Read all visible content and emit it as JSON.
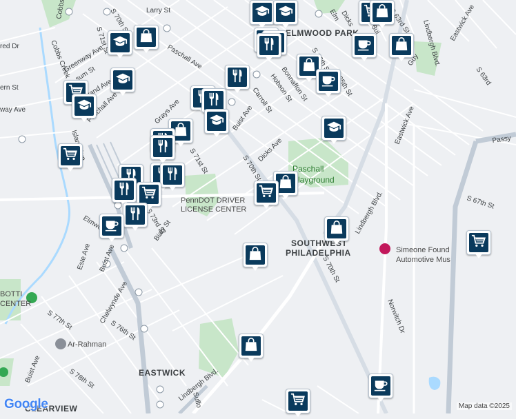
{
  "map": {
    "attribution": "Map data ©2025",
    "logo": "Google",
    "areas": {
      "elmwood_park": "ELMWOOD PARK",
      "southwest_1": "SOUTHWEST",
      "southwest_2": "PHILADELPHIA",
      "eastwick": "EASTWICK",
      "clearview": "CLEARVIEW"
    },
    "parks": {
      "paschall_1": "Paschall",
      "paschall_2": "Playground"
    },
    "pois": {
      "penndot_1": "PennDOT DRIVER",
      "penndot_2": "LICENSE CENTER",
      "simeone_1": "Simeone Found",
      "simeone_2": "Automotive Mus",
      "botti_1": "BOTTI",
      "botti_2": "CENTER",
      "ar_rahman": "Ar-Rahman"
    },
    "streets": {
      "s70th_top": "S 70th St",
      "larry": "Larry St",
      "cobbs": "Cobbs Creek P",
      "cobbs_creek": "Cobbs Creek",
      "s71st_top": "S 71st St",
      "paschall_ave_top": "Paschall Ave",
      "greenway": "Greenway Ave",
      "elm": "Elm",
      "dicks_top": "Dicks",
      "s63rd": "S 63rd St",
      "eastwick_ave_top": "Eastwick Ave",
      "lindbergh_top": "Lindbergh Blvd.",
      "s66th": "S 66th St",
      "s65th": "S 65th St",
      "bonnaffon": "Bonnaffon St",
      "hobson": "Hobson St",
      "carroll": "Carroll St",
      "buist_mid": "Buist Ave",
      "grays": "Grays Ave",
      "dicks_mid": "Dicks Ave",
      "s70th_mid": "S 70th St",
      "s71st_mid": "S 71st St",
      "paschall_ave_left": "Paschall Ave",
      "island": "Island Ave",
      "s73rd": "S 73rd St",
      "bialy": "Bialy St",
      "elmwood": "Elmwood",
      "este": "Este Ave",
      "buist_left": "Buist Ave",
      "chelwynde": "Chelwynde Ave",
      "s76th": "S 76th St",
      "s77th": "S 77th St",
      "s78th": "S 78th St",
      "buist_low": "Buist Ave",
      "lindbergh_mid": "Lindbergh Blvd.",
      "lindbergh_low": "Lindbergh Blvd.",
      "s70th_low": "S 70th St",
      "eastwick_ave_right": "Eastwick Ave",
      "s67th": "S 67th St",
      "passyunk": "Passy",
      "norwitch": "Norwitch Dr",
      "suffolk": "Suffo",
      "guy": "Guy",
      "s63rd_right": "S 63rd",
      "red": "red Dr",
      "ern": "ern St",
      "way": "way Ave",
      "sum": "sum St",
      "land": "land Ave",
      "bui": "Bui"
    },
    "colors": {
      "marker_fill": "#0a3a5c",
      "park": "#c8e6c9",
      "water": "#aadaff",
      "highway": "#c1cbd6"
    },
    "markers": [
      {
        "icon": "school-icon"
      },
      {
        "icon": "school-icon"
      },
      {
        "icon": "cart-icon"
      },
      {
        "icon": "shopping-bag-icon"
      },
      {
        "icon": "restaurant-icon"
      },
      {
        "icon": "restaurant-icon"
      },
      {
        "icon": "restaurant-icon"
      },
      {
        "icon": "coffee-icon"
      },
      {
        "icon": "shopping-bag-icon"
      },
      {
        "icon": "shopping-bag-icon"
      },
      {
        "icon": "school-icon"
      },
      {
        "icon": "shopping-bag-icon"
      },
      {
        "icon": "cart-icon"
      },
      {
        "icon": "restaurant-icon"
      },
      {
        "icon": "coffee-icon"
      },
      {
        "icon": "school-icon"
      },
      {
        "icon": "school-icon"
      },
      {
        "icon": "restaurant-icon"
      },
      {
        "icon": "restaurant-icon"
      },
      {
        "icon": "school-icon"
      },
      {
        "icon": "shopping-bag-icon"
      },
      {
        "icon": "restaurant-icon"
      },
      {
        "icon": "school-icon"
      },
      {
        "icon": "restaurant-icon"
      },
      {
        "icon": "cart-icon"
      },
      {
        "icon": "restaurant-icon"
      },
      {
        "icon": "restaurant-icon"
      },
      {
        "icon": "restaurant-icon"
      },
      {
        "icon": "restaurant-icon"
      },
      {
        "icon": "cart-icon"
      },
      {
        "icon": "shopping-bag-icon"
      },
      {
        "icon": "shopping-bag-icon"
      },
      {
        "icon": "restaurant-icon"
      },
      {
        "icon": "coffee-icon"
      },
      {
        "icon": "shopping-bag-icon"
      },
      {
        "icon": "cart-icon"
      },
      {
        "icon": "cart-icon"
      },
      {
        "icon": "shopping-bag-icon"
      },
      {
        "icon": "coffee-icon"
      },
      {
        "icon": "cart-icon"
      }
    ]
  }
}
